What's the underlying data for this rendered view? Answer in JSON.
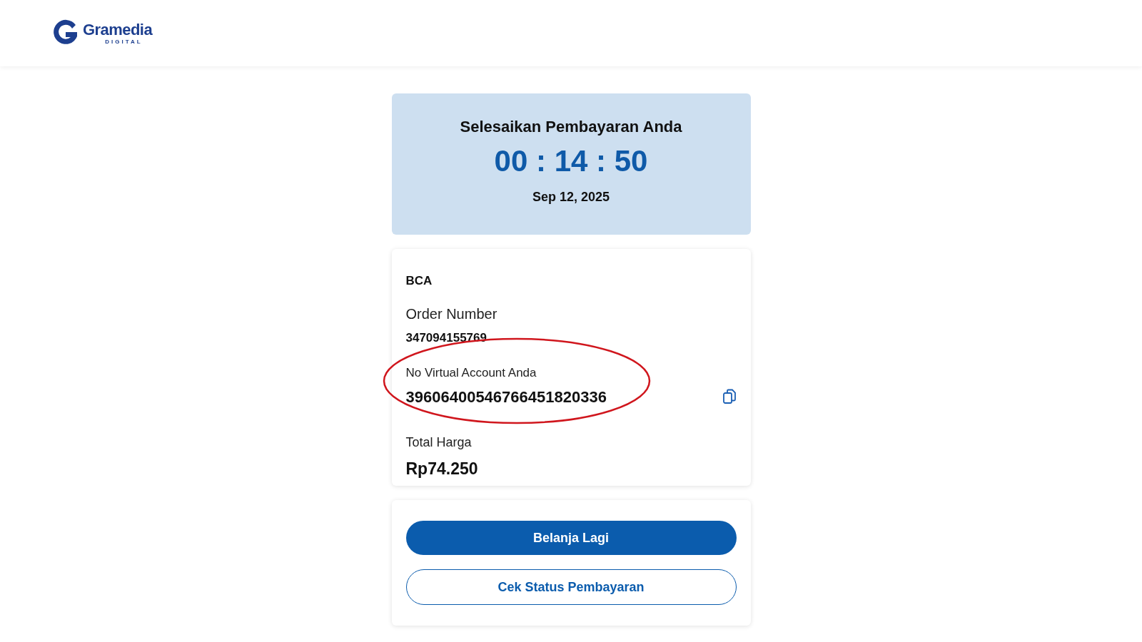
{
  "header": {
    "logo_name": "Gramedia",
    "logo_sub": "DIGITAL"
  },
  "countdown": {
    "title": "Selesaikan Pembayaran Anda",
    "timer": "00 : 14 : 50",
    "date": "Sep 12, 2025"
  },
  "payment": {
    "bank": "BCA",
    "order_label": "Order Number",
    "order_number": "347094155769",
    "va_label": "No Virtual Account Anda",
    "va_number": "39606400546766451820336",
    "total_label": "Total Harga",
    "total": "Rp74.250"
  },
  "buttons": [
    {
      "label": "Belanja Lagi",
      "kind": "primary"
    },
    {
      "label": "Cek Status Pembayaran",
      "kind": "outline"
    }
  ]
}
